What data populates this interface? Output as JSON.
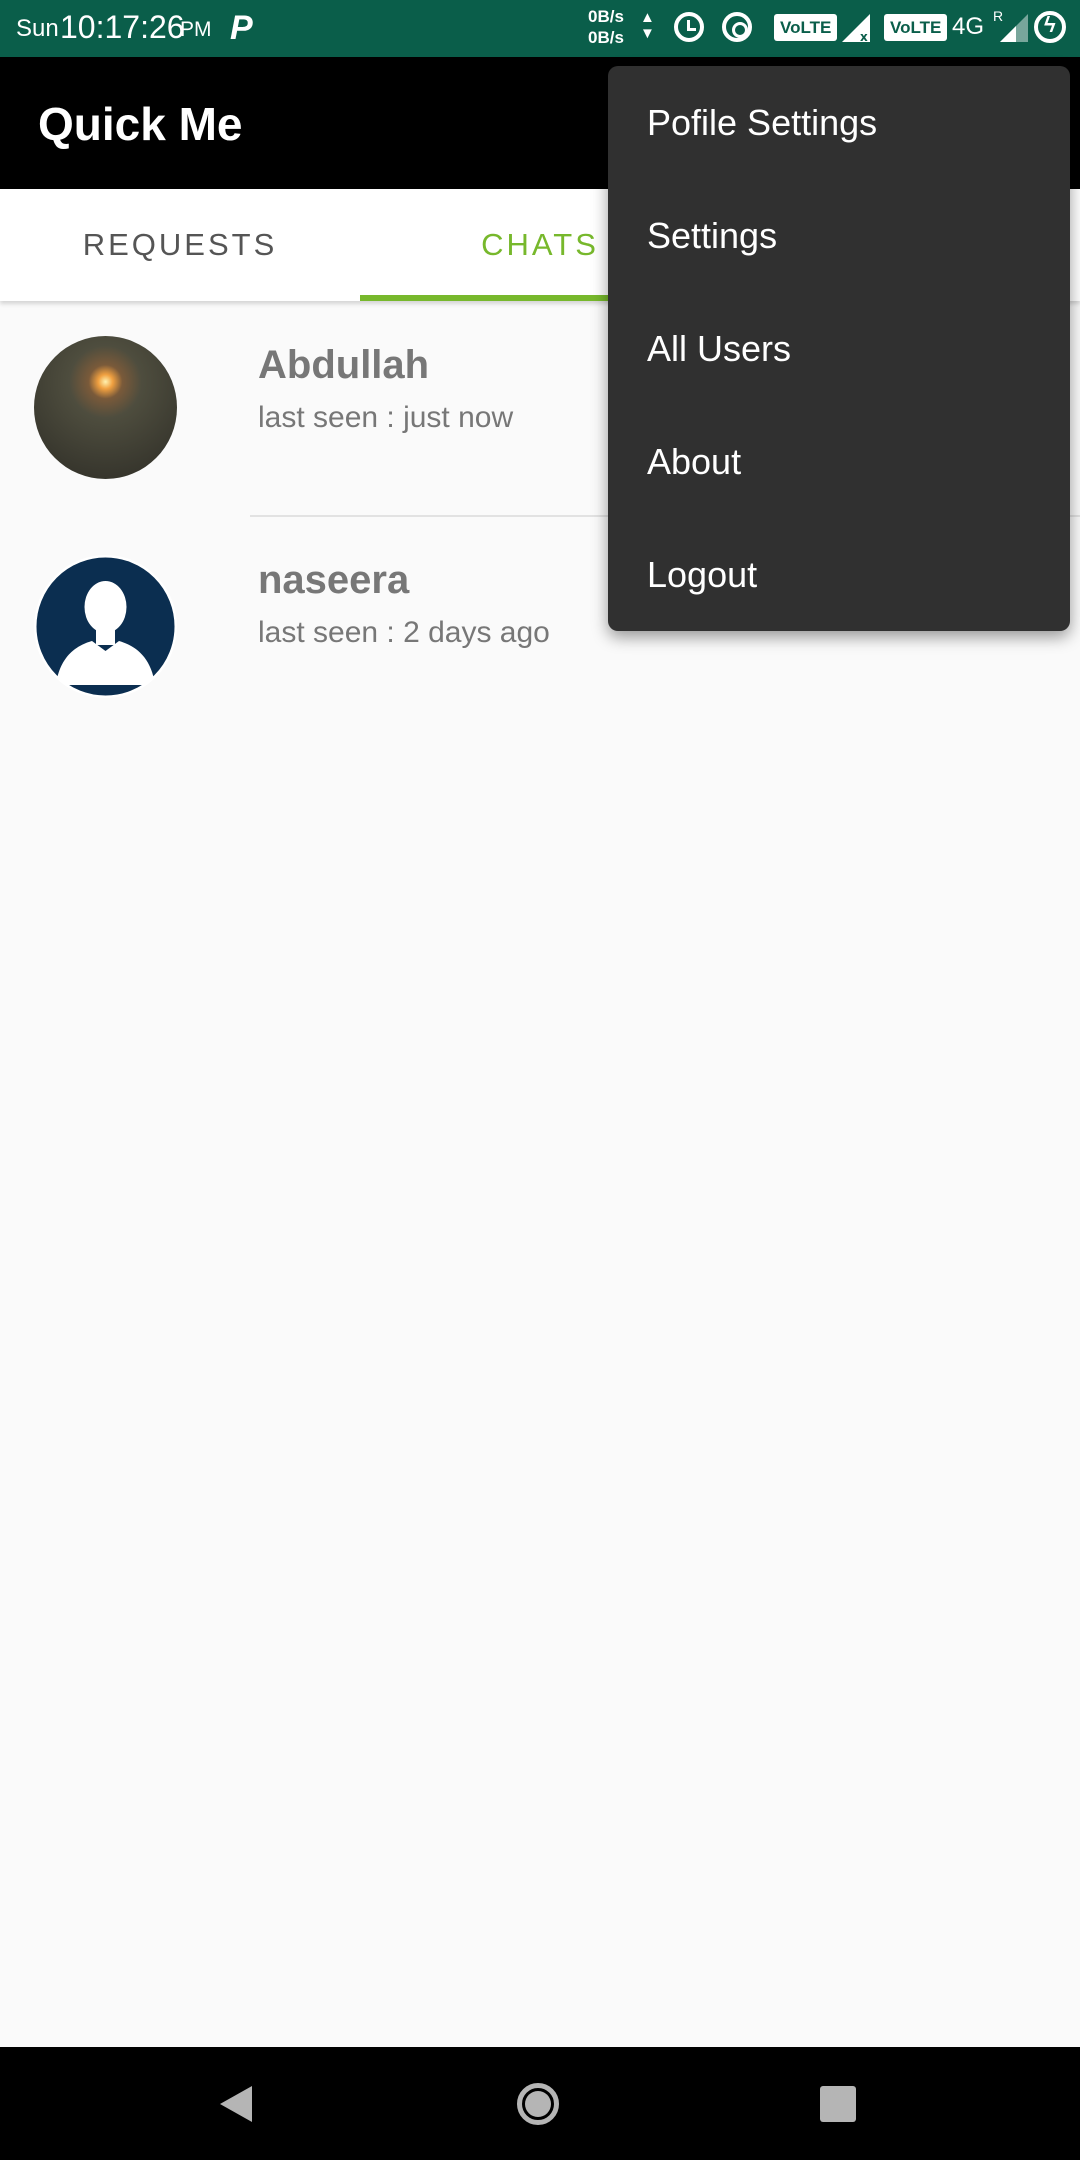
{
  "status_bar": {
    "day": "Sun",
    "time": "10:17:26",
    "ampm": "PM",
    "p_icon": "P",
    "speed_up": "0B/s",
    "speed_down": "0B/s",
    "volte_1": "VoLTE",
    "volte_2": "VoLTE",
    "network": "4G",
    "roaming": "R"
  },
  "app_bar": {
    "title": "Quick Me"
  },
  "tabs": [
    {
      "label": "REQUESTS",
      "selected": false
    },
    {
      "label": "CHATS",
      "selected": true
    }
  ],
  "colors": {
    "accent": "#77b82c",
    "status_bar": "#0a5e4a",
    "app_bar": "#000000",
    "menu_bg": "#303030"
  },
  "chats": [
    {
      "name": "Abdullah",
      "status": "last seen : just now",
      "avatar": "photo-avatar"
    },
    {
      "name": "naseera",
      "status": "last seen : 2 days ago",
      "avatar": "default-person-avatar"
    }
  ],
  "menu": {
    "items": [
      {
        "label": "Pofile Settings"
      },
      {
        "label": "Settings"
      },
      {
        "label": "All Users"
      },
      {
        "label": "About"
      },
      {
        "label": "Logout"
      }
    ]
  },
  "nav_bar": {
    "icons": [
      "back-icon",
      "home-icon",
      "recents-icon"
    ]
  }
}
